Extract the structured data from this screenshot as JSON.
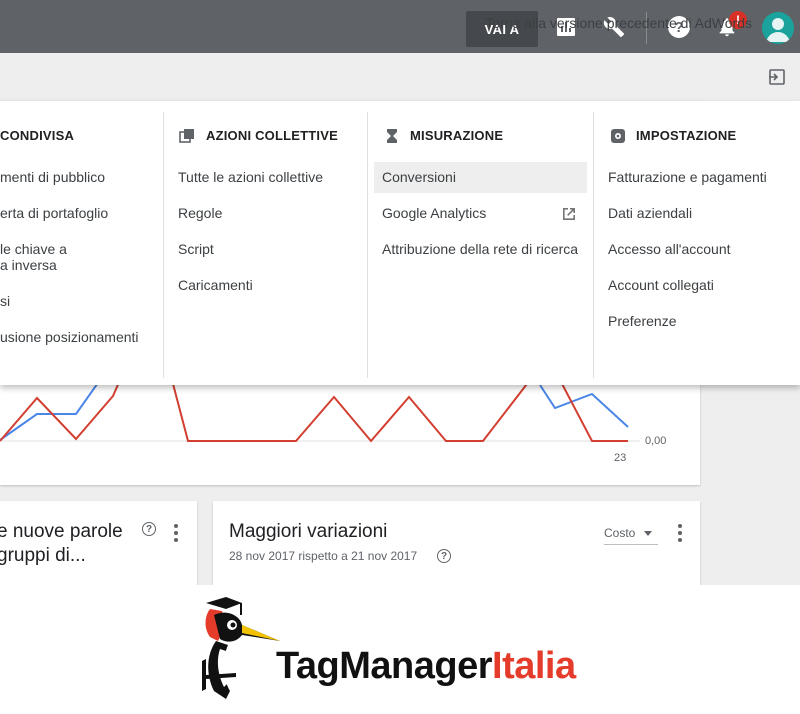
{
  "topbar": {
    "vai_label": "VAI A",
    "badge": "!"
  },
  "subbar": {
    "link_label": "Torna alla versione precedente di AdWords"
  },
  "menu": {
    "col1": {
      "heading": "CONDIVISA",
      "items": [
        "menti di pubblico",
        "erta di portafoglio",
        "le chiave a",
        "a inversa",
        "si",
        "usione posizionamenti"
      ]
    },
    "col2": {
      "heading": "AZIONI COLLETTIVE",
      "items": [
        "Tutte le azioni collettive",
        "Regole",
        "Script",
        "Caricamenti"
      ]
    },
    "col3": {
      "heading": "MISURAZIONE",
      "items": [
        "Conversioni",
        "Google Analytics",
        "Attribuzione della rete di ricerca"
      ]
    },
    "col4": {
      "heading": "IMPOSTAZIONE",
      "items": [
        "Fatturazione e pagamenti",
        "Dati aziendali",
        "Accesso all'account",
        "Account collegati",
        "Preferenze"
      ]
    }
  },
  "chart": {
    "y_label": "0,00",
    "x_label": "23"
  },
  "cards": {
    "left_title_line1": "e nuove parole",
    "left_title_line2": "gruppi di...",
    "right_title": "Maggiori variazioni",
    "right_subtitle": "28 nov 2017 rispetto a 21 nov 2017",
    "metric_select": "Costo"
  },
  "logo": {
    "part1": "TagManager",
    "part2": "Italia"
  },
  "colors": {
    "topbar": "#5f6368",
    "red_series": "#d23f31",
    "blue_series": "#4a86e8",
    "brand_red": "#e53b2b"
  }
}
